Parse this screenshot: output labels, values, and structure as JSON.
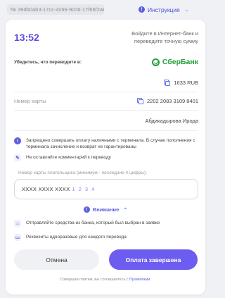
{
  "topbar": {
    "transaction_id": "№ 39db0ab3-17cc-4c66-9c06-17f66f2a869e",
    "instructions_label": "Инструкция"
  },
  "header": {
    "timer": "13:52",
    "hint": "Войдите в Интернет-банк и переведите точную сумму"
  },
  "transfer": {
    "check_label": "Убедитесь, что переводите в:",
    "bank_name": "СберБанк",
    "amount": "1633 RUB",
    "card_label": "Номер карты",
    "card_number": "2202 2083 3109 8401",
    "holder_name": "Абдикадырова Ирода"
  },
  "warnings": [
    "Запрещено совершать оплату наличными с терминала. В случае пополнения с терминала зачисление и возврат не гарантированы",
    "Не оставляйте комментарий к переводу"
  ],
  "payer_card": {
    "label": "Номер карты плательщика (минимум - последние 4 цифры):",
    "mask": "XXXX XXXX XXXX",
    "digits_placeholder": "1 2 3 4"
  },
  "attention": {
    "title": "Внимание",
    "items": [
      "Отправляйте средства из банка, который был выбран в заявке",
      "Реквизиты одноразовые для каждого перевода"
    ]
  },
  "buttons": {
    "cancel": "Отмена",
    "done": "Оплата завершена"
  },
  "footer": {
    "text": "Совершая платеж, вы соглашаетесь с",
    "link": "Правилами."
  }
}
